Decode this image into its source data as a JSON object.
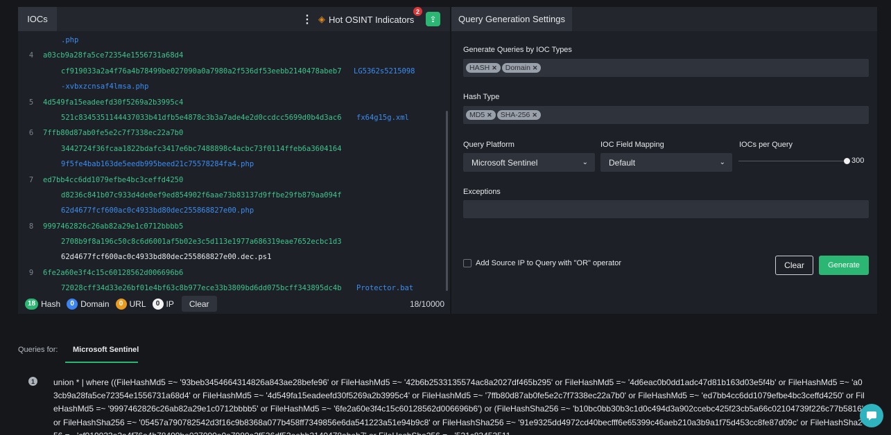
{
  "ioc_panel": {
    "tab_label": "IOCs",
    "hot_osint_label": "Hot OSINT Indicators",
    "hot_osint_badge": "2",
    "lines": [
      {
        "num": "",
        "main": "",
        "extra": ".php",
        "extra_col": 62,
        "extra_class": "file"
      },
      {
        "num": "4",
        "main": "a03cb9a28fa5ce72354e1556731a68d4",
        "extra": "",
        "extra_col": 0,
        "extra_class": ""
      },
      {
        "num": "",
        "main": "",
        "cont": "cf919033a2a4f76a4b78499be027090a0a7980a2f536df53eebb2140478abeb7",
        "extra": "LG5362s5215098",
        "extra_col": 484,
        "extra_class": "file"
      },
      {
        "num": "",
        "main": "",
        "extra": "-xvbxzcnsaf4lmsa.php",
        "extra_col": 62,
        "extra_class": "file"
      },
      {
        "num": "5",
        "main": "4d549fa15eadeefd30f5269a2b3995c4",
        "extra": "",
        "extra_col": 0,
        "extra_class": ""
      },
      {
        "num": "",
        "main": "",
        "cont": "521c8345351144437033b41dfb5e4878c3b3a7ade4e2d0ccdcc5699d0b4d3ac6",
        "extra": "fx64g15g.xml",
        "extra_col": 488,
        "extra_class": "file"
      },
      {
        "num": "6",
        "main": "7ffb80d87ab0fe5e2c7f7338ec22a7b0",
        "extra": "",
        "extra_col": 0,
        "extra_class": ""
      },
      {
        "num": "",
        "main": "",
        "cont": "3442724f36fcaa1822bdafc3417e6bc7488898c4acbc73f0114ffeb6a3604164",
        "extra": "",
        "extra_col": 0,
        "extra_class": ""
      },
      {
        "num": "",
        "main": "",
        "extra": "9f5fe4bab163de5eedb995beed21c75578284fa4.php",
        "extra_col": 62,
        "extra_class": "file"
      },
      {
        "num": "7",
        "main": "ed7bb4cc6dd1079efbe4bc3ceffd4250",
        "extra": "",
        "extra_col": 0,
        "extra_class": ""
      },
      {
        "num": "",
        "main": "",
        "cont": "d8236c841b07c933d4de0ef9ed854902f6aae73b83137d9ffbe29fb879aa094f",
        "extra": "",
        "extra_col": 0,
        "extra_class": ""
      },
      {
        "num": "",
        "main": "",
        "extra": "62d4677fcf600ac0c4933bd80dec255868827e00.php",
        "extra_col": 62,
        "extra_class": "file"
      },
      {
        "num": "8",
        "main": "9997462826c26ab82a29e1c0712bbbb5",
        "extra": "",
        "extra_col": 0,
        "extra_class": ""
      },
      {
        "num": "",
        "main": "",
        "cont": "2708b9f8a196c50c8c6d6001af5b02e3c5d113e1977a686319eae7652ecbc1d3",
        "extra": "",
        "extra_col": 0,
        "extra_class": ""
      },
      {
        "num": "",
        "main": "",
        "extra": "62d4677fcf600ac0c4933bd80dec255868827e00.dec.ps1",
        "extra_col": 62,
        "extra_class": "white"
      },
      {
        "num": "9",
        "main": "6fe2a60e3f4c15c60128562d006696b6",
        "extra": "",
        "extra_col": 0,
        "extra_class": ""
      },
      {
        "num": "",
        "main": "",
        "cont": "72028cff34d33e26bf01e4bf63c8b977ece33b3809bd6dd075bcff343895dc4b",
        "extra": "Protector.bat",
        "extra_col": 488,
        "extra_class": "file"
      }
    ],
    "footer": {
      "hash_count": "18",
      "hash_label": "Hash",
      "domain_count": "0",
      "domain_label": "Domain",
      "url_count": "0",
      "url_label": "URL",
      "ip_count": "0",
      "ip_label": "IP",
      "clear_label": "Clear",
      "counter": "18/10000"
    }
  },
  "settings": {
    "tab_label": "Query Generation Settings",
    "ioc_types_label": "Generate Queries by IOC Types",
    "ioc_types": [
      "HASH",
      "Domain"
    ],
    "hash_type_label": "Hash Type",
    "hash_types": [
      "MD5",
      "SHA-256"
    ],
    "platform_label": "Query Platform",
    "platform_value": "Microsoft Sentinel",
    "mapping_label": "IOC Field Mapping",
    "mapping_value": "Default",
    "per_query_label": "IOCs per Query",
    "per_query_value": "300",
    "per_query_fraction": 1.0,
    "exceptions_label": "Exceptions",
    "source_ip_label": "Add Source IP to Query with \"OR\" operator",
    "clear_label": "Clear",
    "generate_label": "Generate"
  },
  "queries": {
    "for_label": "Queries for:",
    "active_tab": "Microsoft Sentinel",
    "query_number": "1",
    "query_text": "union * | where ((FileHashMd5 =~ '93beb3454664314826a843ae28befe96' or FileHashMd5 =~ '42b6b2533135574ac8a2027df465b295' or FileHashMd5 =~ '4d6eac0b0dd1adc47d81b163d03e5f4b' or FileHashMd5 =~ 'a03cb9a28fa5ce72354e1556731a68d4' or FileHashMd5 =~ '4d549fa15eadeefd30f5269a2b3995c4' or FileHashMd5 =~ '7ffb80d87ab0fe5e2c7f7338ec22a7b0' or FileHashMd5 =~ 'ed7bb4cc6dd1079efbe4bc3ceffd4250' or FileHashMd5 =~ '9997462826c26ab82a29e1c0712bbbb5' or FileHashMd5 =~ '6fe2a60e3f4c15c60128562d006696b6') or (FileHashSha256 =~ 'b10bc0bb30b3c1d0c494d3a902ccebc425f23cb5a66c02104739f226c77b5816' or FileHashSha256 =~ '05457a790782542d3f16c9b8368a077b458ff7349856e6da541223a51e94b9c8' or FileHashSha256 =~ '91e9325dd4972cd40becfff6e65399c46aeb210a3b9a1f75d453cc8fe87d09c' or FileHashSha256 =~ 'cf919033a2a4f76a4b78499be027090a0a7980a2f536df53eebb2140478abeb7' or FileHashSha256 =~ '521c83453511"
  },
  "colors": {
    "accent_green": "#2bb673",
    "hash_green": "#3fc48a",
    "file_blue": "#3c8df0",
    "domain_blue": "#3c84f0",
    "url_orange": "#e89b1f"
  }
}
